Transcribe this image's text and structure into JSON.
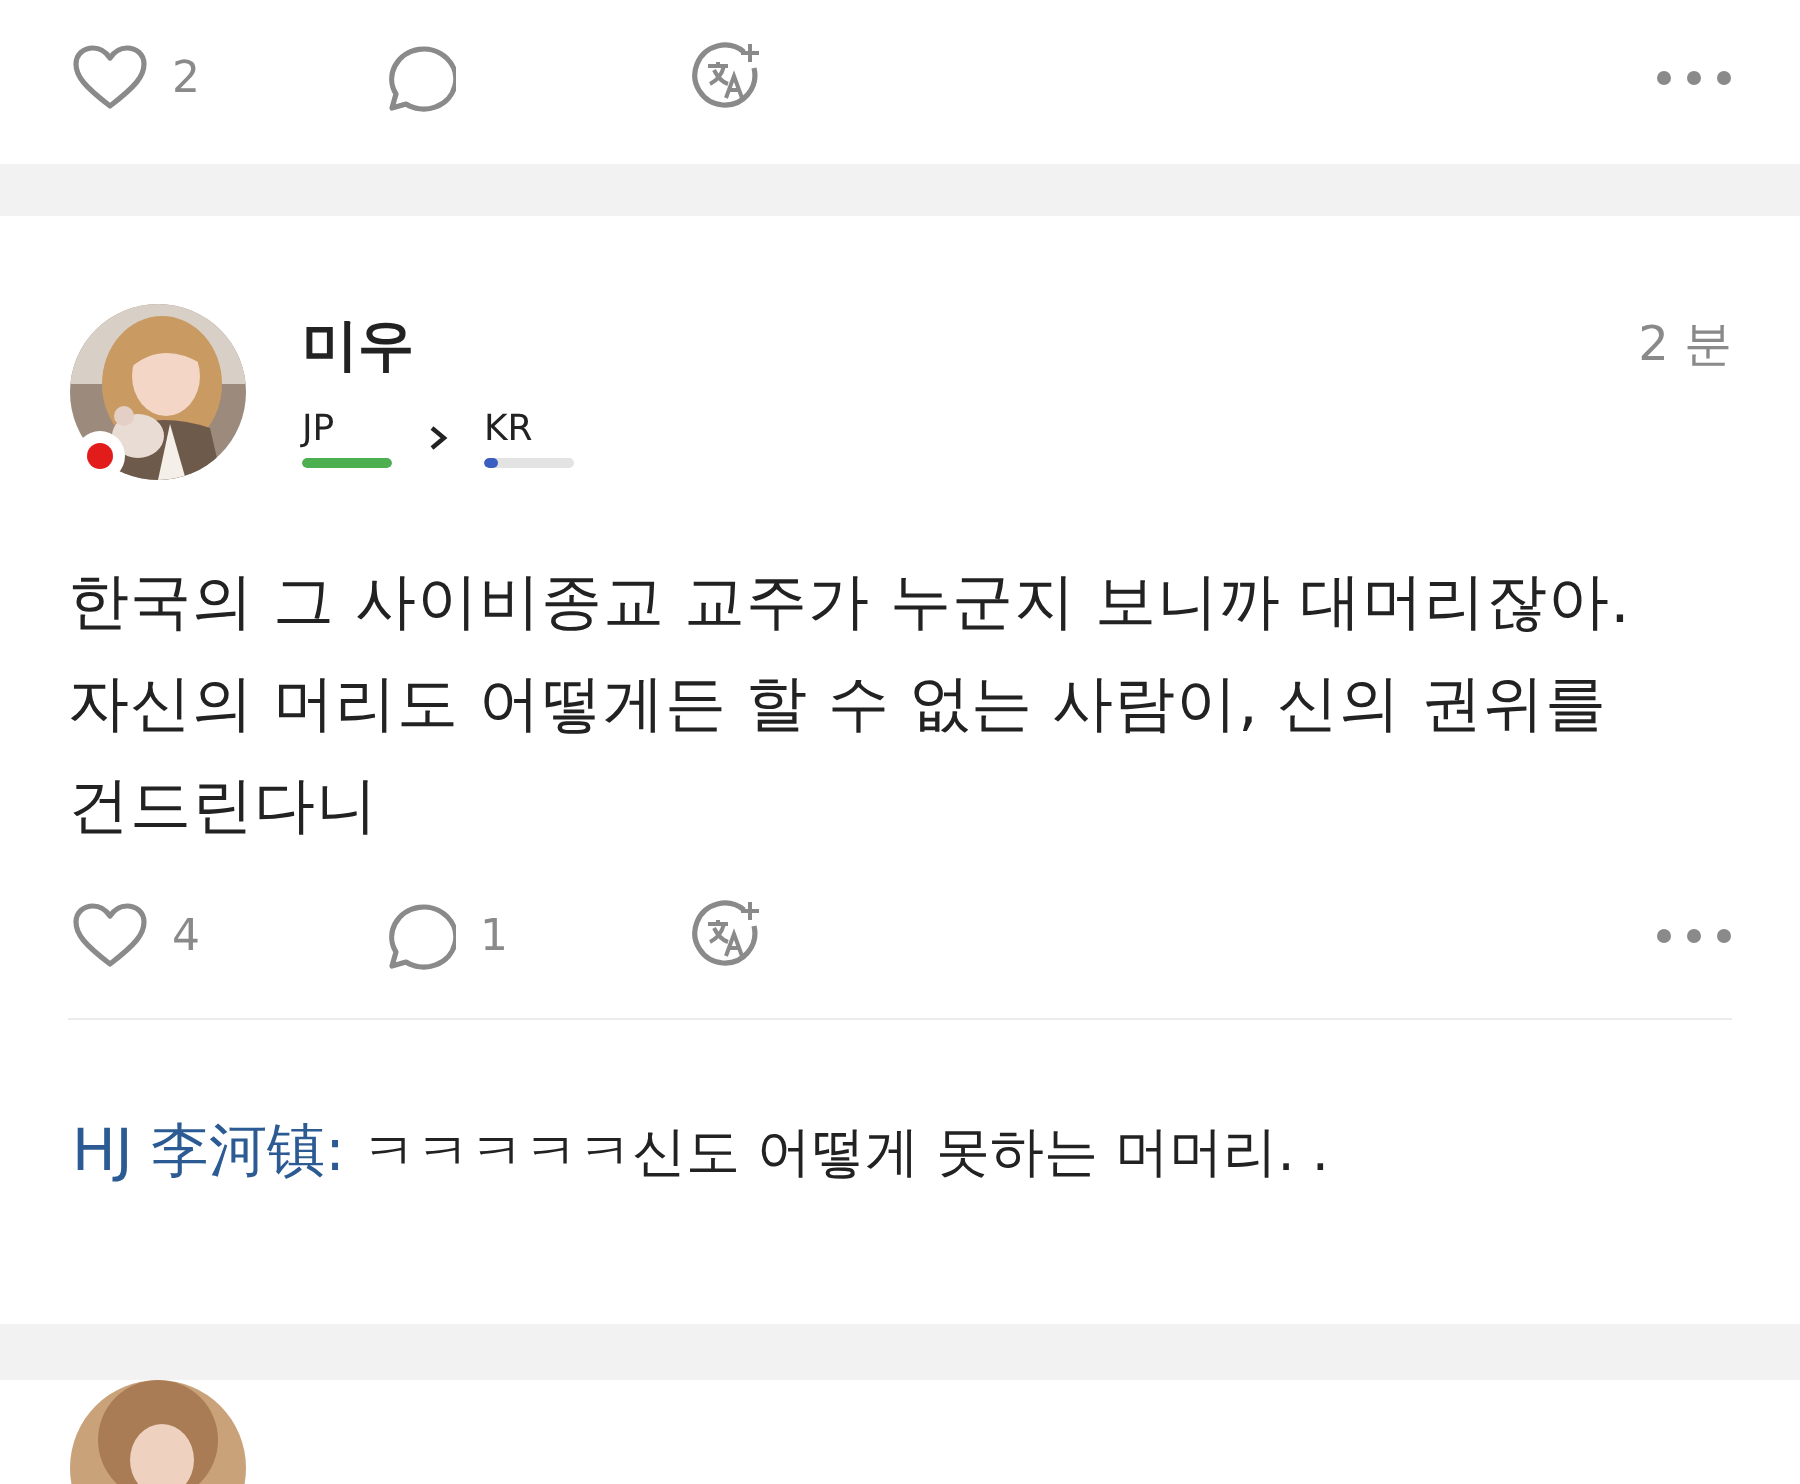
{
  "previous_post": {
    "actions": {
      "likes": "2"
    }
  },
  "post": {
    "author": "미우",
    "time": "2 분",
    "languages": [
      {
        "code": "JP",
        "level": 1.0,
        "color": "#4caf50"
      },
      {
        "code": "KR",
        "level": 0.15,
        "color": "#3b5fc0"
      }
    ],
    "body": "한국의 그 사이비종교 교주가 누군지 보니까 대머리잖아. 자신의 머리도 어떻게든 할 수 없는 사람이, 신의 권위를 건드린다니",
    "actions": {
      "likes": "4",
      "comments": "1"
    },
    "comments": [
      {
        "author": "HJ 李河镇:",
        "text": "ㅋㅋㅋㅋㅋ신도 어떻게 못하는 머머리. ."
      }
    ]
  }
}
